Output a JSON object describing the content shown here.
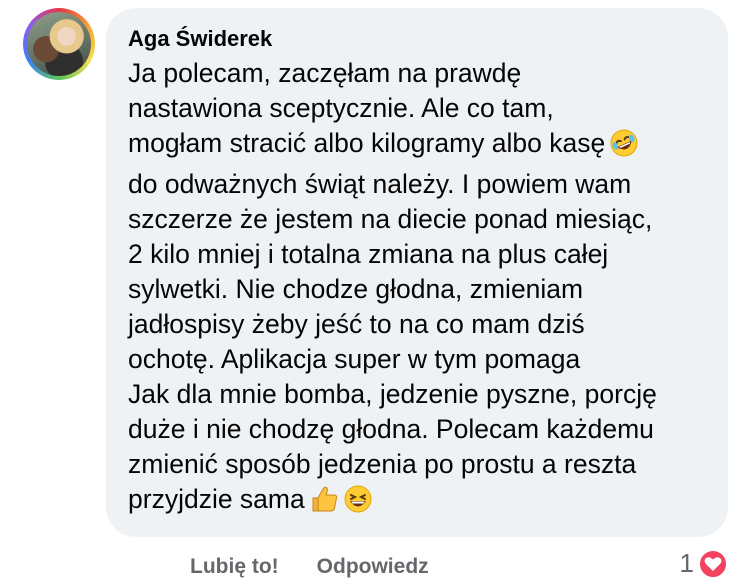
{
  "comment": {
    "author": "Aga Świderek",
    "lines": [
      "Ja polecam, zaczęłam na prawdę",
      "nastawiona sceptycznie. Ale co tam,",
      "mogłam stracić albo kilogramy albo kasę",
      "do odważnych świąt należy. I powiem wam",
      "szczerze że jestem na diecie ponad  miesiąc,",
      "2 kilo mniej i totalna zmiana na plus całej",
      "sylwetki. Nie chodze głodna, zmieniam",
      "jadłospisy żeby jeść to na co mam dziś",
      "ochotę. Aplikacja super w tym pomaga",
      "Jak dla mnie bomba, jedzenie pyszne, porcję",
      "duże i nie chodzę głodna. Polecam każdemu",
      "zmienić sposób jedzenia po prostu a reszta",
      "przyjdzie sama"
    ],
    "emojis": {
      "line3": "rolling-on-floor-laughing-emoji",
      "line13": [
        "thumbs-up-emoji",
        "grinning-squinting-emoji"
      ]
    }
  },
  "actions": {
    "like_label": "Lubię to!",
    "reply_label": "Odpowiedz"
  },
  "reactions": {
    "count": "1",
    "type": "heart-icon",
    "color": "#f3425f"
  },
  "colors": {
    "bubble": "#eff2f5",
    "text": "#050505",
    "secondary_text": "#65676b"
  }
}
